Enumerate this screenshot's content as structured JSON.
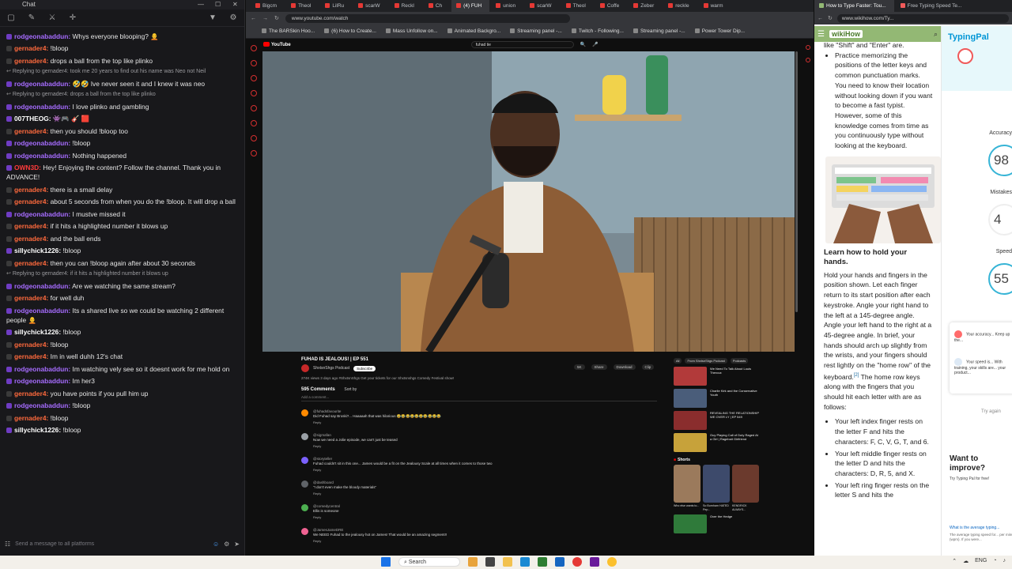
{
  "chat": {
    "window_title": "Chat",
    "input_placeholder": "Send a message to all platforms",
    "messages": [
      {
        "user": "rodgeonabaddun:",
        "color": "#a66cff",
        "text": "Whys everyone blooping? 🧑‍🦲"
      },
      {
        "user": "gernader4:",
        "color": "#ff6a3d",
        "text": "!bloop"
      },
      {
        "user": "gernader4:",
        "color": "#ff6a3d",
        "text": "drops a ball from the top like plinko"
      },
      {
        "reply": "Replying to gernader4:",
        "reply_text": "took me 20 years to find out his name was Neo not Neil"
      },
      {
        "user": "rodgeonabaddun:",
        "color": "#a66cff",
        "text": "🤣🤣 Ive never seen it and I knew it was neo"
      },
      {
        "reply": "Replying to gernader4:",
        "reply_text": "drops a ball from the top like plinko"
      },
      {
        "user": "rodgeonabaddun:",
        "color": "#a66cff",
        "text": "I love plinko and gambling"
      },
      {
        "user": "007THEOG:",
        "color": "#ffffff",
        "text": "👾🎮 🎸 🟥"
      },
      {
        "user": "gernader4:",
        "color": "#ff6a3d",
        "text": "then you should !bloop too"
      },
      {
        "user": "rodgeonabaddun:",
        "color": "#a66cff",
        "text": "!bloop"
      },
      {
        "user": "rodgeonabaddun:",
        "color": "#a66cff",
        "text": "Nothing happened"
      },
      {
        "user": "OWN3D:",
        "color": "#ff3b3b",
        "text": "Hey! Enjoying the content? Follow the channel. Thank you in ADVANCE!"
      },
      {
        "user": "gernader4:",
        "color": "#ff6a3d",
        "text": "there is a small delay"
      },
      {
        "user": "gernader4:",
        "color": "#ff6a3d",
        "text": "about 5 seconds from when you do the !bloop. It will drop a ball"
      },
      {
        "user": "rodgeonabaddun:",
        "color": "#a66cff",
        "text": "I mustve missed it"
      },
      {
        "user": "gernader4:",
        "color": "#ff6a3d",
        "text": "if it hits a highlighted number it blows up"
      },
      {
        "user": "gernader4:",
        "color": "#ff6a3d",
        "text": "and the ball ends"
      },
      {
        "user": "sillychick1226:",
        "color": "#ffffff",
        "text": "!bloop"
      },
      {
        "user": "gernader4:",
        "color": "#ff6a3d",
        "text": "then you can !bloop again after about 30 seconds"
      },
      {
        "reply": "Replying to gernader4:",
        "reply_text": "if it hits a highlighted number it blows up"
      },
      {
        "user": "rodgeonabaddun:",
        "color": "#a66cff",
        "text": "Are we watching the same stream?"
      },
      {
        "user": "gernader4:",
        "color": "#ff6a3d",
        "text": "for well duh"
      },
      {
        "user": "rodgeonabaddun:",
        "color": "#a66cff",
        "text": "Its a shared live so we could be watching 2 different people 🧑‍🦲"
      },
      {
        "user": "sillychick1226:",
        "color": "#ffffff",
        "text": "!bloop"
      },
      {
        "user": "gernader4:",
        "color": "#ff6a3d",
        "text": "!bloop"
      },
      {
        "user": "gernader4:",
        "color": "#ff6a3d",
        "text": "Im in well duhh 12's chat"
      },
      {
        "user": "rodgeonabaddun:",
        "color": "#a66cff",
        "text": "Im watching vely see so it doesnt work for me hold on"
      },
      {
        "user": "rodgeonabaddun:",
        "color": "#a66cff",
        "text": "Im her3"
      },
      {
        "user": "gernader4:",
        "color": "#ff6a3d",
        "text": "you have points if you pull him up"
      },
      {
        "user": "rodgeonabaddun:",
        "color": "#a66cff",
        "text": "!bloop"
      },
      {
        "user": "gernader4:",
        "color": "#ff6a3d",
        "text": "!bloop"
      },
      {
        "user": "sillychick1226:",
        "color": "#ffffff",
        "text": "!bloop"
      }
    ]
  },
  "browser_left": {
    "tabs": [
      "Bigcm",
      "Theol",
      "LilRu",
      "scarW",
      "Reckl",
      "Ch",
      "union",
      "scarW",
      "Theol",
      "Coffe",
      "Zeber",
      "reckle",
      "warm"
    ],
    "active_tab": "(4) FUH",
    "url": "www.youtube.com/watch",
    "bookmarks": [
      "The BARSkin Hoo...",
      "(6) How to Create...",
      "Mass Unfollow on...",
      "Animated Backgro...",
      "Streaming panel -...",
      "Twitch - Following...",
      "Streaming panel -...",
      "Power Tower Dip..."
    ],
    "youtube": {
      "logo": "YouTube",
      "search_value": "fuhad tie",
      "video_title": "FUHAD IS JEALOUS! | EP 551",
      "channel": "ShxtsnShgs Podcast",
      "subscribe": "Subscribe",
      "actions": [
        "5K",
        "Share",
        "Download",
        "Clip"
      ],
      "description": "274K views  3 days ago  #ShxtsnShgs\nGet your tickets for our Shxtsnshgs Comedy Festival show!",
      "comments_count": "595 Comments",
      "sort_label": "Sort by",
      "add_comment": "Add a comment...",
      "comments": [
        {
          "user": "@fuhadsfavourite",
          "text": "Did Fuhad say Broski?... Haaaaah that was hilarious 😂😂😂😂😂😂😂😂😂😂",
          "reply": "Reply"
        },
        {
          "user": "@sigmafan",
          "text": "Now we need a Jolie episode, we can't just be teased",
          "reply": "Reply"
        },
        {
          "user": "@storyteller",
          "text": "Fuhad couldn't sit in this one... James would be a fit on the Jealousy Scale at all times when it comes to those two",
          "reply": "Reply"
        },
        {
          "user": "@dashboard",
          "text": "\"I don't even make the bloody materials\"",
          "reply": "Reply"
        },
        {
          "user": "@comedycentral",
          "text": "Ellis is someone",
          "reply": "Reply"
        },
        {
          "user": "@JamesJameDRE",
          "text": "We NEED Fuhad to the jealousy hot on James! That would be an amazing segment!!",
          "reply": "Reply"
        }
      ],
      "chips": [
        "All",
        "From ShxtsnShgs Podcast",
        "Podcasts"
      ],
      "recs": [
        {
          "title": "We Need To Talk About Louis Theroux"
        },
        {
          "title": "Charlie Kirk and the Conservative Youth"
        },
        {
          "title": "REVEALING THE RELATIONSHIP WE OVER LY | EP 549"
        },
        {
          "title": "Guy Playing Call of Duty Raged At a Girl | Ragebait Girlfriend"
        }
      ],
      "shorts_label": "Shorts",
      "shorts": [
        "Who else wants to...",
        "So Burnham HATED Pep...",
        "KENDRICK ALWAYS..."
      ],
      "last_rec": "Over the Hedge"
    }
  },
  "browser_right": {
    "active_tab": "How to Type Faster: Tou...",
    "second_tab": "Free Typing Speed Te...",
    "url": "www.wikihow.com/Ty...",
    "wikihow": {
      "logo": "wikiHow",
      "cut_line": "like \"Shift\" and \"Enter\" are.",
      "bullet1": "Practice memorizing the positions of the letter keys and common punctuation marks. You need to know their location without looking down if you want to become a fast typist. However, some of this knowledge comes from time as you continuously type without looking at the keyboard.",
      "step_title": "Learn how to hold your hands.",
      "step_text": "Hold your hands and fingers in the position shown. Let each finger return to its start position after each keystroke. Angle your right hand to the left at a 145-degree angle. Angle your left hand to the right at a 45-degree angle. In brief, your hands should arch up slightly from the wrists, and your fingers should rest lightly on the \"home row\" of the keyboard.",
      "footnote": "[2]",
      "step_text2": "The home row keys along with the fingers that you should hit each letter with are as follows:",
      "bullets": [
        "Your left index finger rests on the letter F and hits the characters: F, C, V, G, T, and 6.",
        "Your left middle finger rests on the letter D and hits the characters: D, R, 5, and X.",
        "Your left ring finger rests on the letter S and hits the"
      ]
    },
    "typingpal": {
      "logo": "TypingPal",
      "accuracy_label": "Accuracy",
      "accuracy_value": "98",
      "mistakes_label": "Mistakes",
      "mistakes_value": "4",
      "speed_label": "Speed",
      "speed_value": "55",
      "card_line1": "Your accuracy... Keep up the...",
      "card_line2": "Your speed is... With training, your skills are... your product...",
      "try_again": "Try again",
      "improve": "Want to improve?",
      "improve_sub": "Try Typing Pal for free!",
      "bottom_link": "What is the average typing...",
      "bottom_text": "The average typing speed for... per minute (wpm). If you were..."
    }
  },
  "taskbar": {
    "search_label": "Search",
    "tray_time": "ENG"
  }
}
